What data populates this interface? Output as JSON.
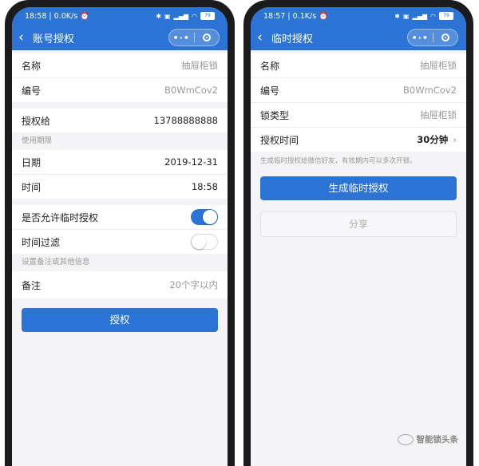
{
  "left": {
    "status": {
      "time": "18:58",
      "speed": "0.0K/s",
      "battery": "79"
    },
    "nav": {
      "title": "账号授权"
    },
    "rows": {
      "name": {
        "label": "名称",
        "value": "抽屉柜锁"
      },
      "serial": {
        "label": "编号",
        "value": "B0WmCov2"
      },
      "grantee": {
        "label": "授权给",
        "value": "13788888888"
      },
      "period": "使用期限",
      "date": {
        "label": "日期",
        "value": "2019-12-31"
      },
      "time": {
        "label": "时间",
        "value": "18:58"
      },
      "allow_temp": {
        "label": "是否允许临时授权",
        "on": true
      },
      "time_filter": {
        "label": "时间过滤",
        "on": false
      },
      "remark_section": "设置备注或其他信息",
      "remark": {
        "label": "备注",
        "placeholder": "20个字以内"
      }
    },
    "button": "授权"
  },
  "right": {
    "status": {
      "time": "18:57",
      "speed": "0.1K/s",
      "battery": "79"
    },
    "nav": {
      "title": "临时授权"
    },
    "rows": {
      "name": {
        "label": "名称",
        "value": "抽屉柜锁"
      },
      "serial": {
        "label": "编号",
        "value": "B0WmCov2"
      },
      "lock_type": {
        "label": "锁类型",
        "value": "抽屉柜锁"
      },
      "duration": {
        "label": "授权时间",
        "value": "30分钟"
      }
    },
    "note": "生成临时授权给微信好友，有效期内可以多次开锁。",
    "generate_button": "生成临时授权",
    "share_button": "分享"
  },
  "watermark": "智能锁头条",
  "icons": {
    "back": "chevron-left-icon",
    "more": "more-dots-icon",
    "close": "close-ring-icon",
    "chevron": "chevron-right-icon"
  },
  "colors": {
    "accent": "#2b73d4",
    "background": "#f4f4f6"
  }
}
